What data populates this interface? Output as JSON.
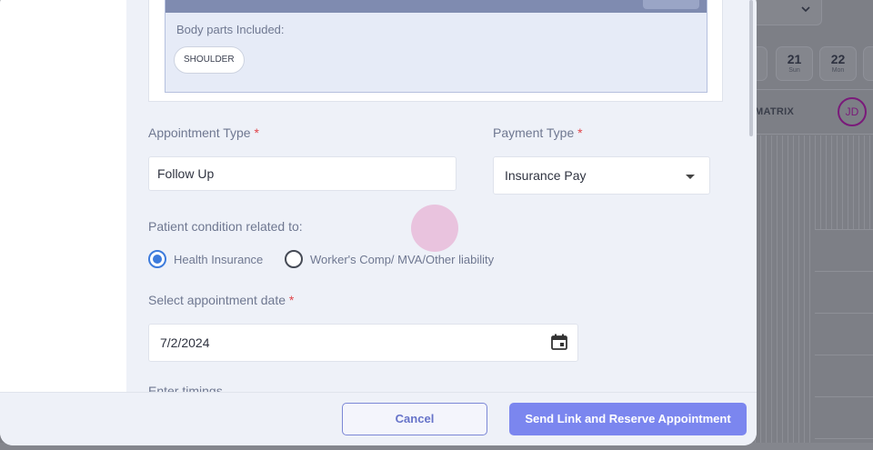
{
  "background_calendar": {
    "days": [
      {
        "num": "",
        "dow": ""
      },
      {
        "num": "21",
        "dow": "Sun"
      },
      {
        "num": "22",
        "dow": "Mon"
      },
      {
        "num": "",
        "dow": ""
      }
    ],
    "matrix_label": "MATRIX",
    "avatar_initials": "JD"
  },
  "body_parts": {
    "label": "Body parts Included:",
    "chips": [
      "SHOULDER"
    ]
  },
  "appointment_type": {
    "label": "Appointment Type",
    "required_mark": "*",
    "value": "Follow Up"
  },
  "payment_type": {
    "label": "Payment Type",
    "required_mark": "*",
    "value": "Insurance Pay"
  },
  "condition": {
    "label": "Patient condition related to:",
    "options": [
      {
        "label": "Health Insurance",
        "selected": true
      },
      {
        "label": "Worker's Comp/ MVA/Other liability",
        "selected": false
      }
    ]
  },
  "appointment_date": {
    "label": "Select appointment date",
    "required_mark": "*",
    "value": "7/2/2024"
  },
  "timings": {
    "label": "Enter timings"
  },
  "footer": {
    "cancel_label": "Cancel",
    "send_label": "Send Link and Reserve Appointment"
  },
  "colors": {
    "primary": "#7b86ef",
    "radio_selected": "#3d7bdc",
    "required": "#e0454b"
  }
}
